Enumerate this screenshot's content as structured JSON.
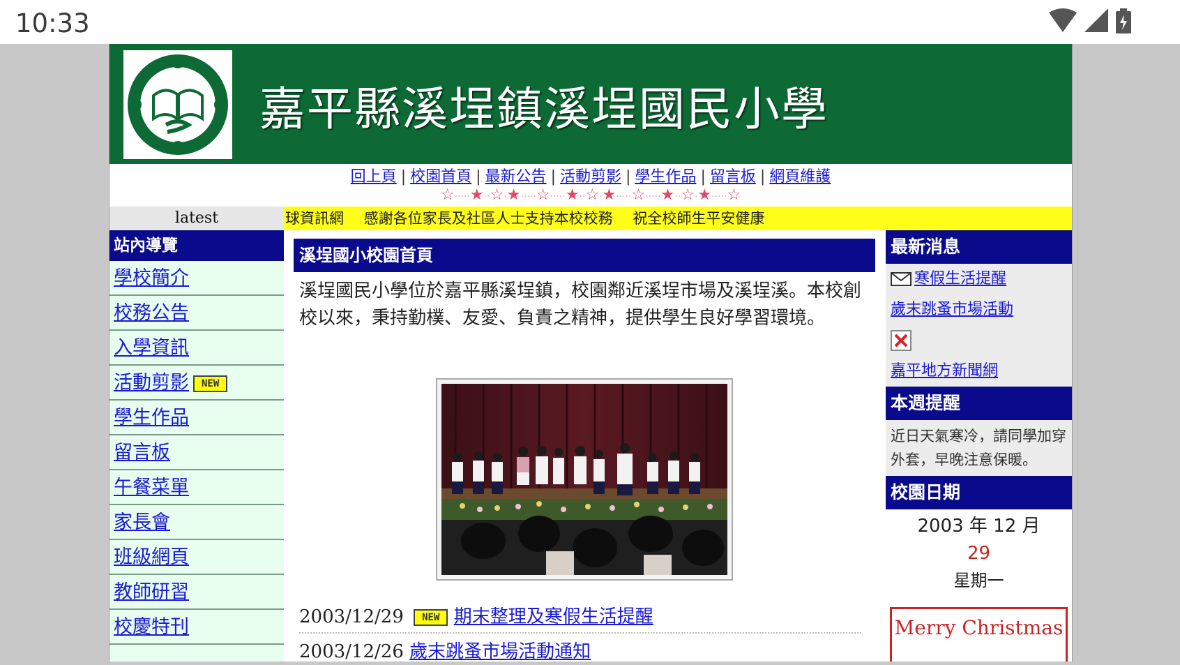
{
  "status_bar": {
    "time": "10:33"
  },
  "banner": {
    "title": "嘉平縣溪埕鎮溪埕國民小學"
  },
  "top_nav": {
    "links": [
      "回上頁",
      "校園首頁",
      "最新公告",
      "活動剪影",
      "學生作品",
      "留言板",
      "網頁維護"
    ],
    "separator": "|"
  },
  "ticker": {
    "label": "latest",
    "items": [
      "球資訊網",
      "感謝各位家長及社區人士支持本校校務",
      "祝全校師生平安健康"
    ]
  },
  "sidebar": {
    "title": "站內導覽",
    "items": [
      "學校簡介",
      "校務公告",
      "入學資訊",
      "活動剪影",
      "學生作品",
      "留言板",
      "午餐菜單",
      "家長會",
      "班級網頁",
      "教師研習",
      "校慶特刊"
    ],
    "new_badge": "NEW"
  },
  "main": {
    "heading": "溪埕國小校園首頁",
    "intro": "溪埕國民小學位於嘉平縣溪埕鎮，校園鄰近溪埕市場及溪埕溪。本校創校以來，秉持勤樸、友愛、負責之精神，提供學生良好學習環境。",
    "news": [
      {
        "date": "2003/12/29",
        "badge": "NEW",
        "title": "期末整理及寒假生活提醒"
      },
      {
        "date": "2003/12/26",
        "badge": "",
        "title": "歲末跳蚤市場活動通知"
      }
    ]
  },
  "right": {
    "latest_title": "最新消息",
    "latest_links": [
      "寒假生活提醒",
      "歲末跳蚤市場活動"
    ],
    "news_site_link": "嘉平地方新聞網",
    "weekly_title": "本週提醒",
    "weekly_text": "近日天氣寒冷，請同學加穿外套，早晚注意保暖。",
    "date_title": "校園日期",
    "date_ym": "2003 年 12 月",
    "date_day": "29",
    "date_weekday": "星期一",
    "greeting": "Merry Christmas"
  },
  "colors": {
    "banner_green": "#0d6a35",
    "nav_blue": "#0a0a8c",
    "link_blue": "#1a1ad6",
    "ticker_yellow": "#ffff1a",
    "sidebar_mint": "#e8fff0",
    "accent_red": "#cc2222"
  }
}
